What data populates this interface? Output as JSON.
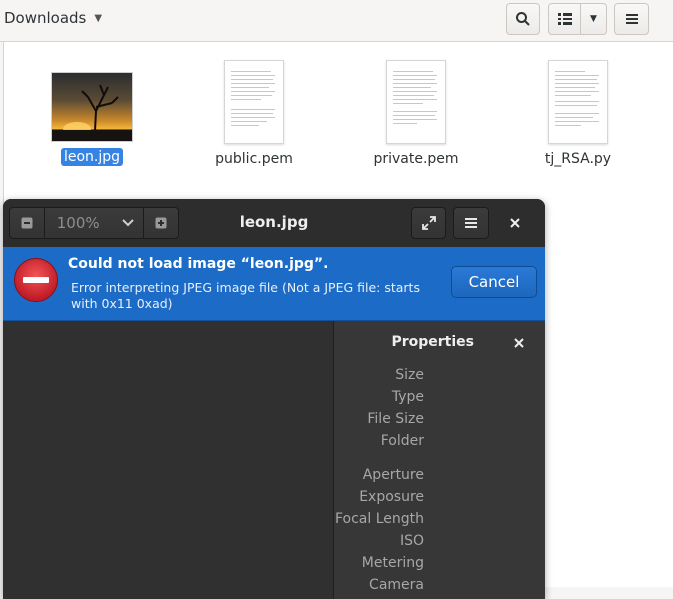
{
  "files": {
    "location": "Downloads",
    "items": [
      {
        "name": "leon.jpg",
        "type": "image",
        "selected": true
      },
      {
        "name": "public.pem",
        "type": "document",
        "selected": false
      },
      {
        "name": "private.pem",
        "type": "document",
        "selected": false
      },
      {
        "name": "tj_RSA.py",
        "type": "document",
        "selected": false
      }
    ],
    "icons": {
      "search": "search-icon",
      "view": "list-view-icon",
      "menu": "hamburger-menu-icon"
    }
  },
  "viewer": {
    "title": "leon.jpg",
    "zoom": "100%",
    "error": {
      "title": "Could not load image “leon.jpg”.",
      "detail": "Error interpreting JPEG image file (Not a JPEG file: starts with 0x11 0xad)",
      "cancel_label": "Cancel"
    },
    "properties": {
      "title": "Properties",
      "rows": [
        "Size",
        "Type",
        "File Size",
        "Folder",
        "Aperture",
        "Exposure",
        "Focal Length",
        "ISO",
        "Metering",
        "Camera"
      ]
    }
  },
  "colors": {
    "accent": "#3584e4",
    "info_bar": "#1c6cc7",
    "error_red": "#c01c28"
  }
}
